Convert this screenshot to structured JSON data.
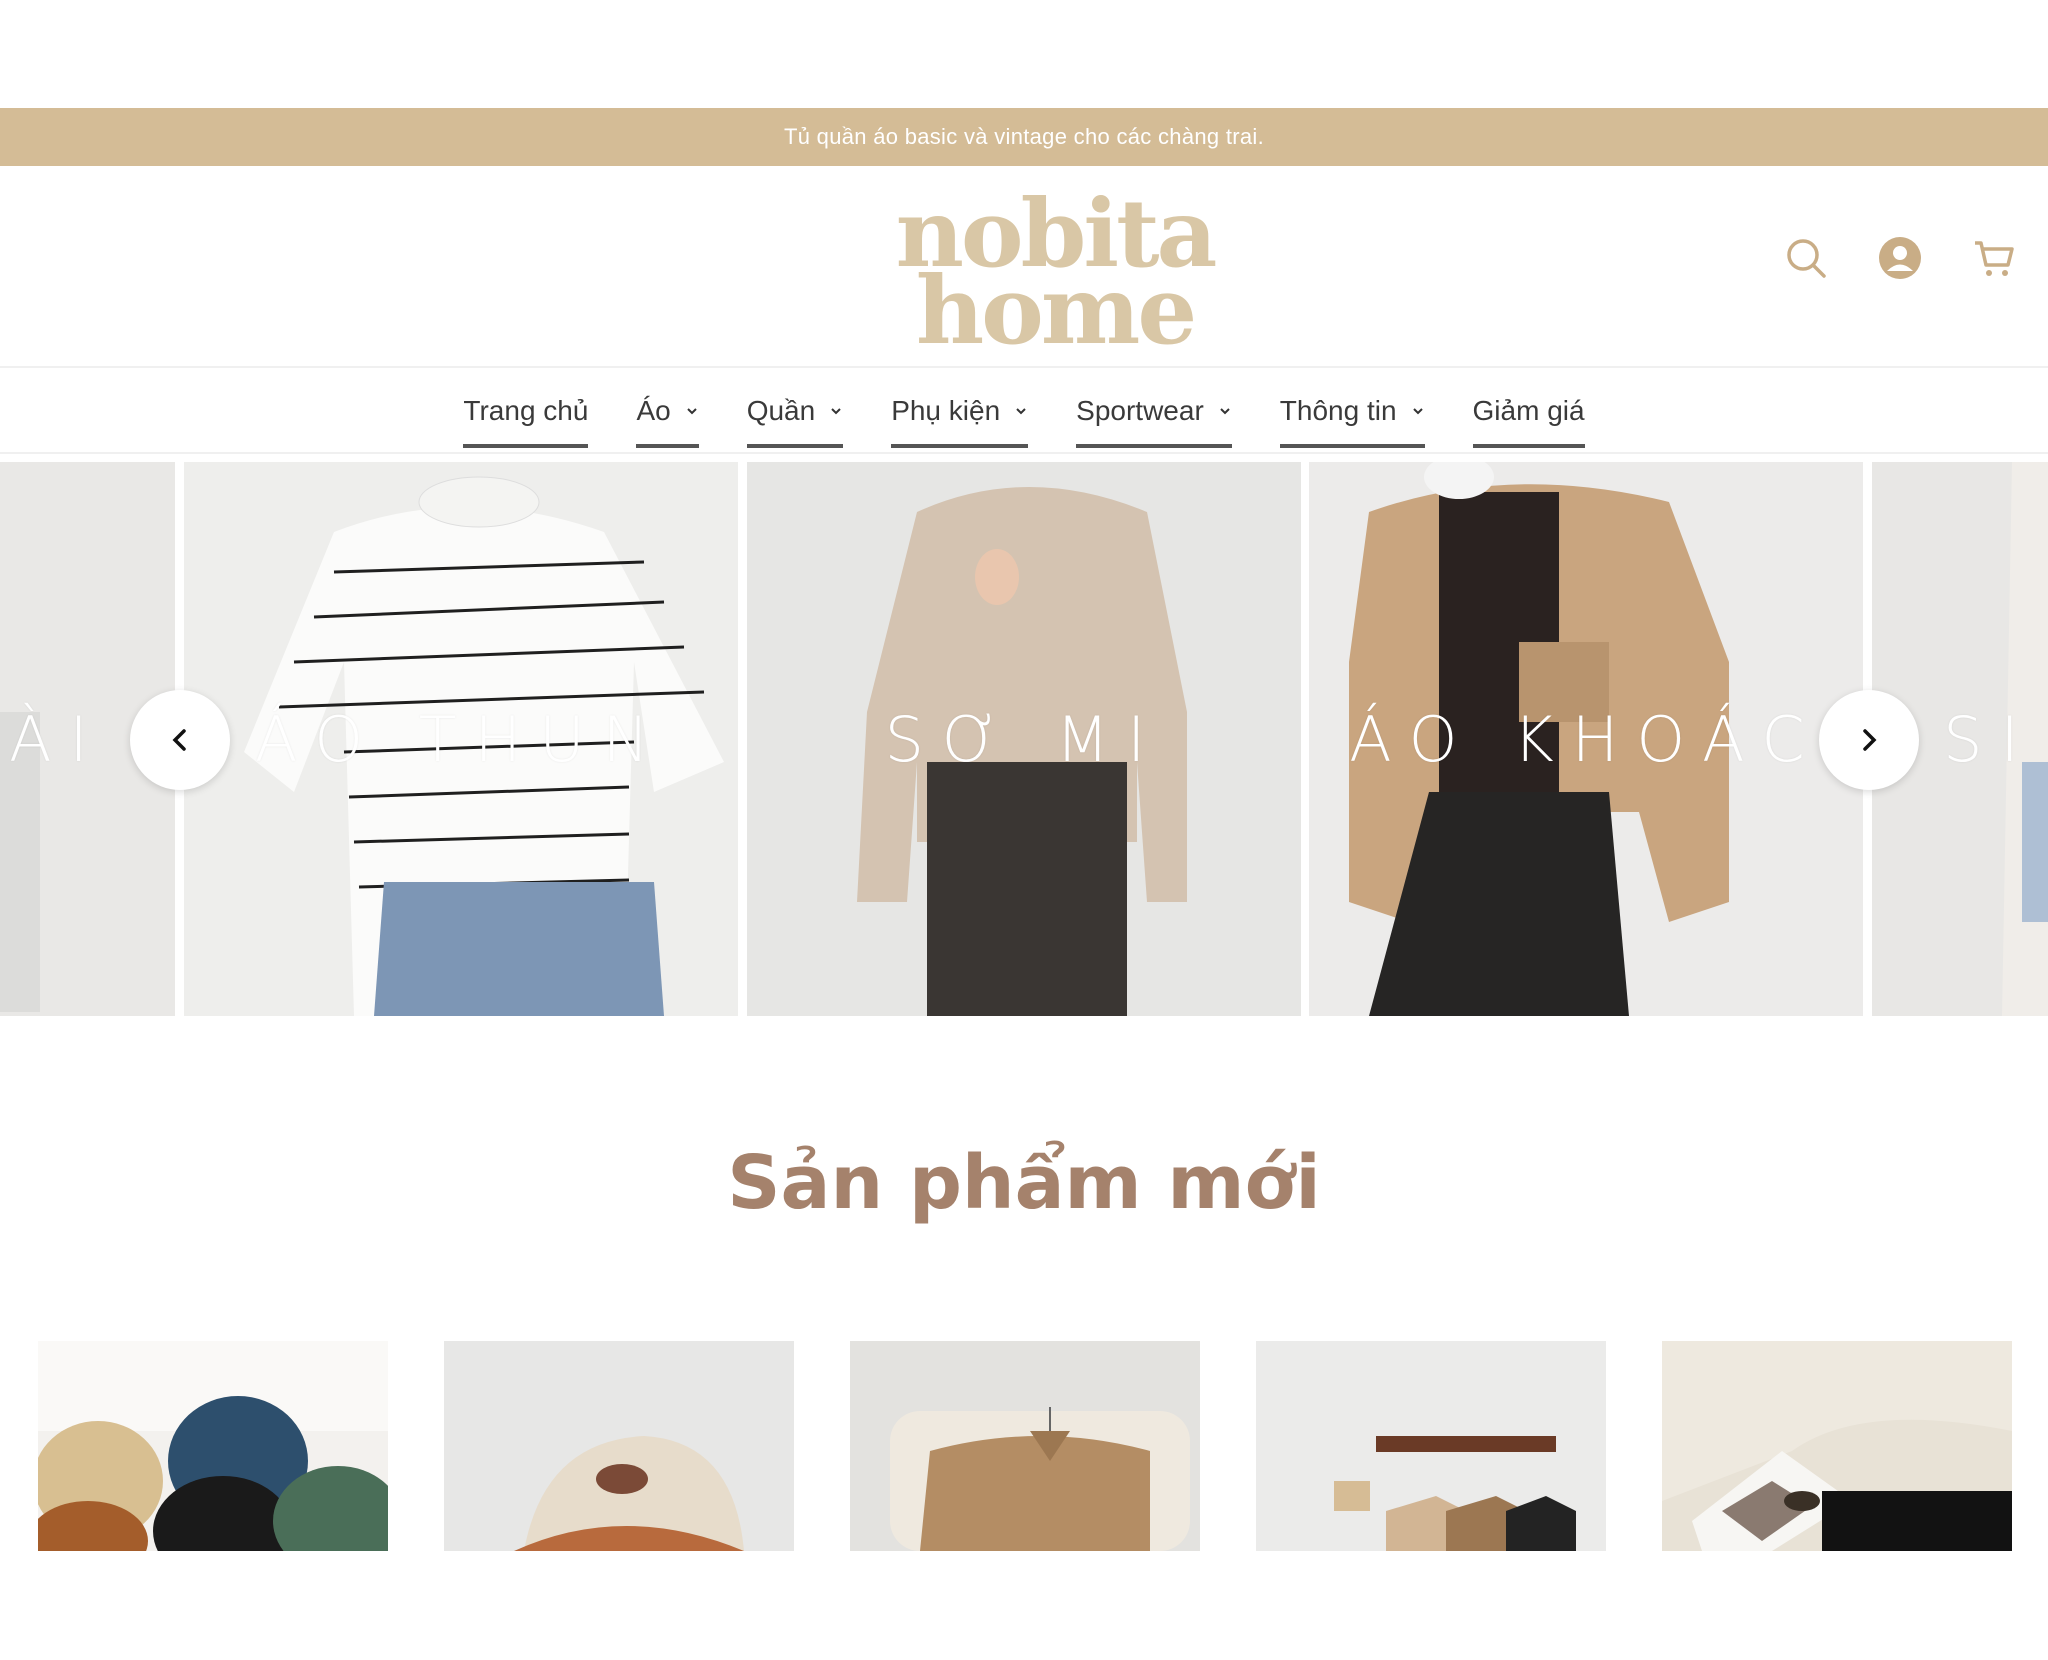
{
  "announcement": "Tủ quần áo basic và vintage cho các chàng trai.",
  "brand": {
    "line1": "nobita",
    "line2": "home"
  },
  "header_icons": [
    "search-icon",
    "account-icon",
    "cart-icon"
  ],
  "nav": [
    {
      "label": "Trang chủ",
      "dropdown": false
    },
    {
      "label": "Áo",
      "dropdown": true
    },
    {
      "label": "Quần",
      "dropdown": true
    },
    {
      "label": "Phụ kiện",
      "dropdown": true
    },
    {
      "label": "Sportwear",
      "dropdown": true
    },
    {
      "label": "Thông tin",
      "dropdown": true
    },
    {
      "label": "Giảm giá",
      "dropdown": false
    }
  ],
  "slider": {
    "slides": [
      {
        "label": "ÀI"
      },
      {
        "label": "ÁO THUN"
      },
      {
        "label": "SƠ MI"
      },
      {
        "label": "ÁO KHOÁC"
      },
      {
        "label": "SI"
      }
    ],
    "prev_icon": "chevron-left-icon",
    "next_icon": "chevron-right-icon"
  },
  "new_products": {
    "title": "Sản phẩm mới",
    "items": [
      {
        "image": "caps-1988-product-image"
      },
      {
        "image": "beige-cap-product-image"
      },
      {
        "image": "brown-shirt-product-image"
      },
      {
        "image": "tshirts-on-rack-product-image"
      },
      {
        "image": "book-sunglasses-product-image"
      }
    ]
  },
  "colors": {
    "accent": "#d4bc96",
    "title": "#a5826c",
    "logo": "#d9c7a6"
  }
}
